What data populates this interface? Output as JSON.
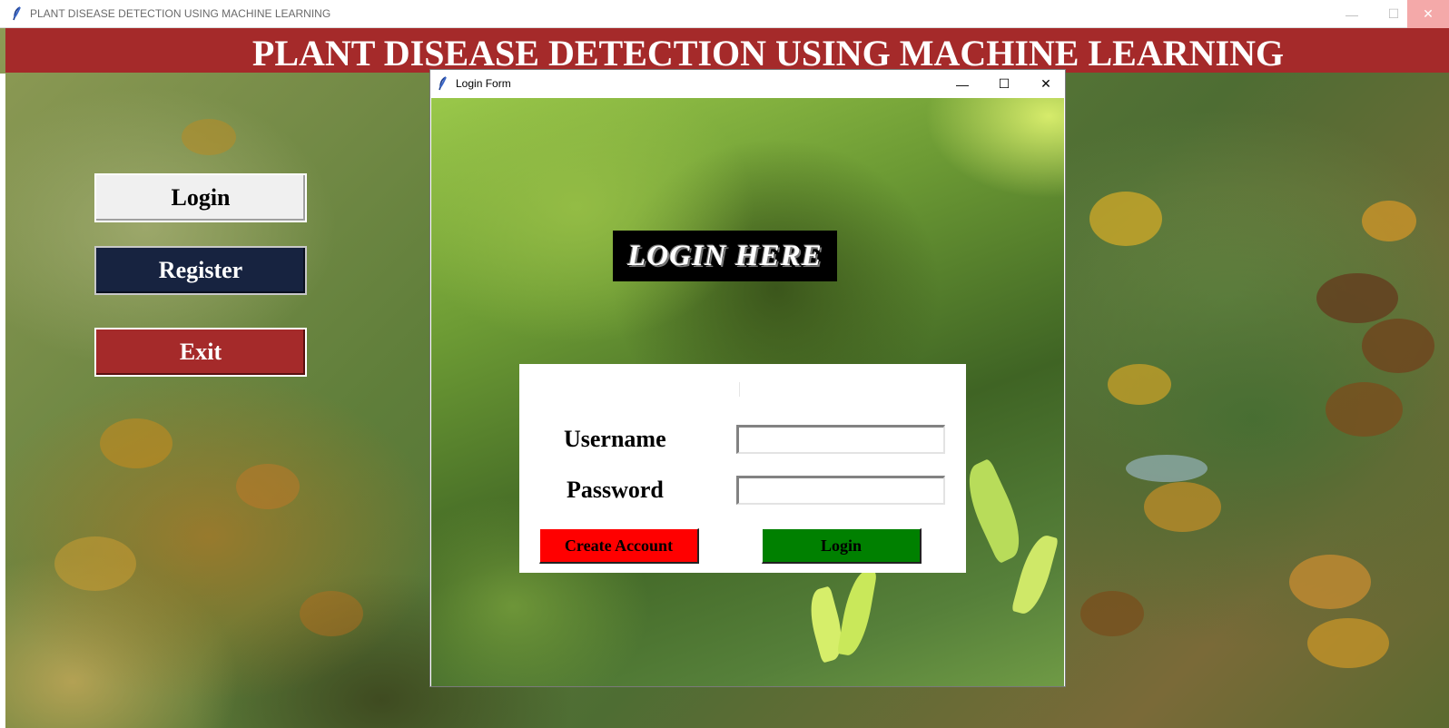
{
  "window": {
    "title": "PLANT DISEASE DETECTION USING MACHINE LEARNING",
    "controls": {
      "minimize": "—",
      "maximize": "☐",
      "close": "✕"
    }
  },
  "banner": {
    "title": "PLANT DISEASE DETECTION USING MACHINE LEARNING"
  },
  "menu": {
    "login_label": "Login",
    "register_label": "Register",
    "exit_label": "Exit"
  },
  "login_window": {
    "title": "Login Form",
    "controls": {
      "minimize": "—",
      "maximize": "☐",
      "close": "✕"
    },
    "heading": "LOGIN HERE",
    "username_label": "Username",
    "password_label": "Password",
    "username_value": "",
    "password_value": "",
    "create_account_label": "Create Account",
    "login_label": "Login"
  },
  "colors": {
    "banner": "#a52a2a",
    "register_button": "#172340",
    "exit_button": "#a52a2a",
    "create_account_button": "#ff0000",
    "login_submit_button": "#008000"
  },
  "icons": {
    "app_icon": "feather-icon"
  }
}
